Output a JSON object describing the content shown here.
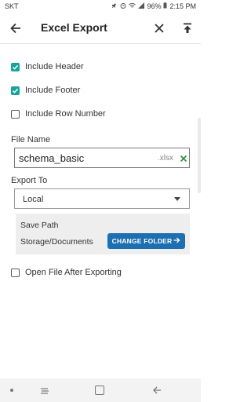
{
  "status_bar": {
    "carrier": "SKT",
    "battery": "96%",
    "time": "2:15 PM"
  },
  "app_bar": {
    "title": "Excel Export",
    "icons": [
      "back-arrow-icon",
      "close-icon",
      "export-icon"
    ]
  },
  "options": [
    {
      "label": "Include Header",
      "checked": true
    },
    {
      "label": "Include Footer",
      "checked": true
    },
    {
      "label": "Include Row Number",
      "checked": false
    }
  ],
  "file_name": {
    "label": "File Name",
    "value": "schema_basic",
    "extension": ".xlsx"
  },
  "export_to": {
    "label": "Export To",
    "selected": "Local"
  },
  "save_path": {
    "title": "Save Path",
    "path": "Storage/Documents",
    "button_label": "CHANGE FOLDER"
  },
  "open_after": {
    "label": "Open File After Exporting",
    "checked": false
  },
  "colors": {
    "accent_teal": "#17a39c",
    "button_blue": "#1c6fb0",
    "clear_green": "#2e8b3a"
  }
}
